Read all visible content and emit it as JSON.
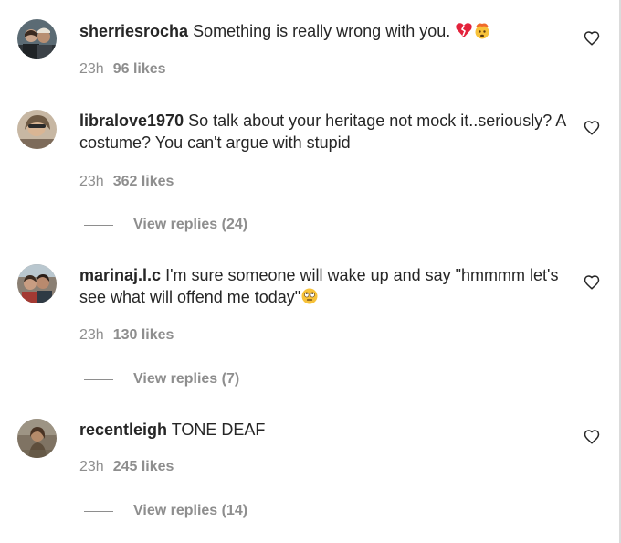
{
  "comments": [
    {
      "username": "sherriesrocha",
      "text": "Something is really wrong with you.",
      "emoji": [
        "broken-heart",
        "exploding-head"
      ],
      "time": "23h",
      "likes": "96 likes",
      "replies": null
    },
    {
      "username": "libralove1970",
      "text": "So talk about your heritage not mock it..seriously? A costume? You can't argue with stupid",
      "emoji": [],
      "time": "23h",
      "likes": "362 likes",
      "replies": "View replies (24)"
    },
    {
      "username": "marinaj.l.c",
      "text": "I'm sure someone will wake up and say \"hmmmm let's see what will offend me today\"",
      "emoji": [
        "face-with-rolling-eyes"
      ],
      "time": "23h",
      "likes": "130 likes",
      "replies": "View replies (7)"
    },
    {
      "username": "recentleigh",
      "text": "TONE DEAF",
      "emoji": [],
      "time": "23h",
      "likes": "245 likes",
      "replies": "View replies (14)"
    }
  ],
  "icons": {
    "like": "heart-outline-icon"
  },
  "colors": {
    "text": "#262626",
    "secondary": "#8e8e8e"
  }
}
